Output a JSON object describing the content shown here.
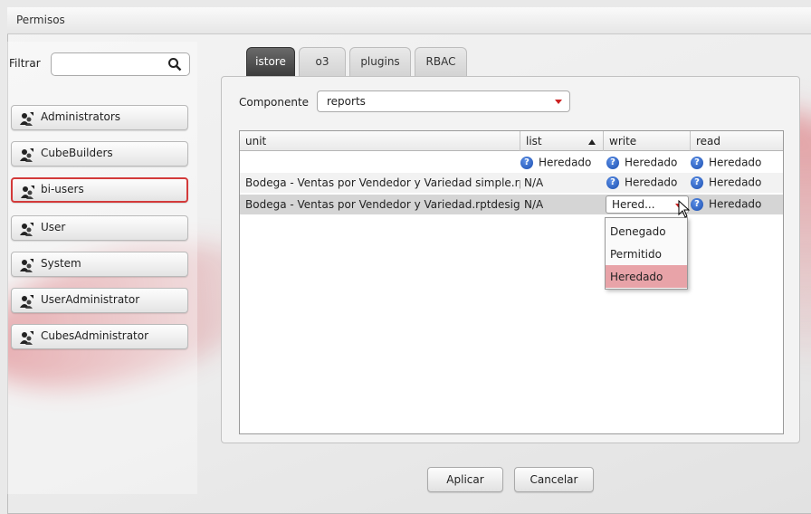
{
  "dialog": {
    "title": "Permisos"
  },
  "filter": {
    "label": "Filtrar",
    "value": "",
    "placeholder": ""
  },
  "users": [
    {
      "label": "Administrators",
      "selected": false
    },
    {
      "label": "CubeBuilders",
      "selected": false
    },
    {
      "label": "bi-users",
      "selected": true
    },
    {
      "label": "User",
      "selected": false
    },
    {
      "label": "System",
      "selected": false
    },
    {
      "label": "UserAdministrator",
      "selected": false
    },
    {
      "label": "CubesAdministrator",
      "selected": false
    }
  ],
  "tabs": [
    {
      "label": "istore",
      "active": true
    },
    {
      "label": "o3",
      "active": false
    },
    {
      "label": "plugins",
      "active": false
    },
    {
      "label": "RBAC",
      "active": false
    }
  ],
  "componente": {
    "label": "Componente",
    "value": "reports"
  },
  "grid": {
    "columns": [
      "unit",
      "list",
      "write",
      "read"
    ],
    "sorted_column": "list",
    "rows": [
      {
        "unit": "",
        "list": "Heredado",
        "write": "Heredado",
        "read": "Heredado"
      },
      {
        "unit": "Bodega - Ventas por Vendedor y Variedad simple.rptdesign",
        "list": "N/A",
        "write": "Heredado",
        "read": "Heredado"
      },
      {
        "unit": "Bodega - Ventas por Vendedor y Variedad.rptdesign",
        "list": "N/A",
        "write": "Hered...",
        "read": "Heredado"
      }
    ]
  },
  "dropdown": {
    "options": [
      "Denegado",
      "Permitido",
      "Heredado"
    ],
    "highlighted": "Heredado"
  },
  "buttons": {
    "apply": "Aplicar",
    "cancel": "Cancelar"
  },
  "icons": {
    "user": "user-group-icon",
    "help": "question-icon",
    "search": "search-icon"
  },
  "colors": {
    "selection_border": "#d33a3a",
    "highlight": "#e8a3a8",
    "help_icon": "#1c4fb0",
    "dropdown_caret": "#cc2222"
  }
}
